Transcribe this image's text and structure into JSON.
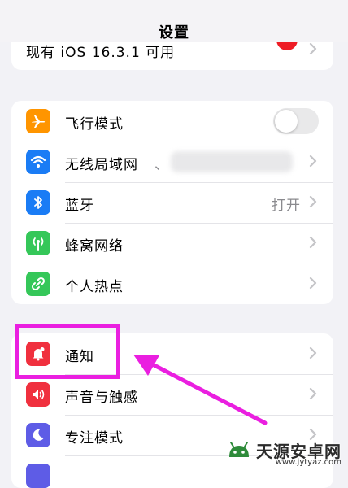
{
  "header": {
    "title": "设置"
  },
  "update_row": {
    "label": "现有 iOS 16.3.1 可用"
  },
  "group1": {
    "items": [
      {
        "label": "飞行模式",
        "icon": "airplane-icon",
        "color": "#ff9500",
        "toggle_on": false
      },
      {
        "label": "无线局域网",
        "icon": "wifi-icon",
        "color": "#1a7cf5",
        "value": "、"
      },
      {
        "label": "蓝牙",
        "icon": "bluetooth-icon",
        "color": "#1a7cf5",
        "value": "打开"
      },
      {
        "label": "蜂窝网络",
        "icon": "cellular-icon",
        "color": "#35c759"
      },
      {
        "label": "个人热点",
        "icon": "hotspot-icon",
        "color": "#35c759"
      }
    ]
  },
  "group2": {
    "items": [
      {
        "label": "通知",
        "icon": "notification-icon",
        "color": "#f0303e"
      },
      {
        "label": "声音与触感",
        "icon": "sound-icon",
        "color": "#f0303e"
      },
      {
        "label": "专注模式",
        "icon": "moon-icon",
        "color": "#5e5ce6"
      }
    ]
  },
  "watermark": {
    "text": "天源安卓网",
    "url": "www.jytyaz.com"
  },
  "colors": {
    "highlight": "#ea1fe0",
    "background": "#f2f2f6"
  }
}
